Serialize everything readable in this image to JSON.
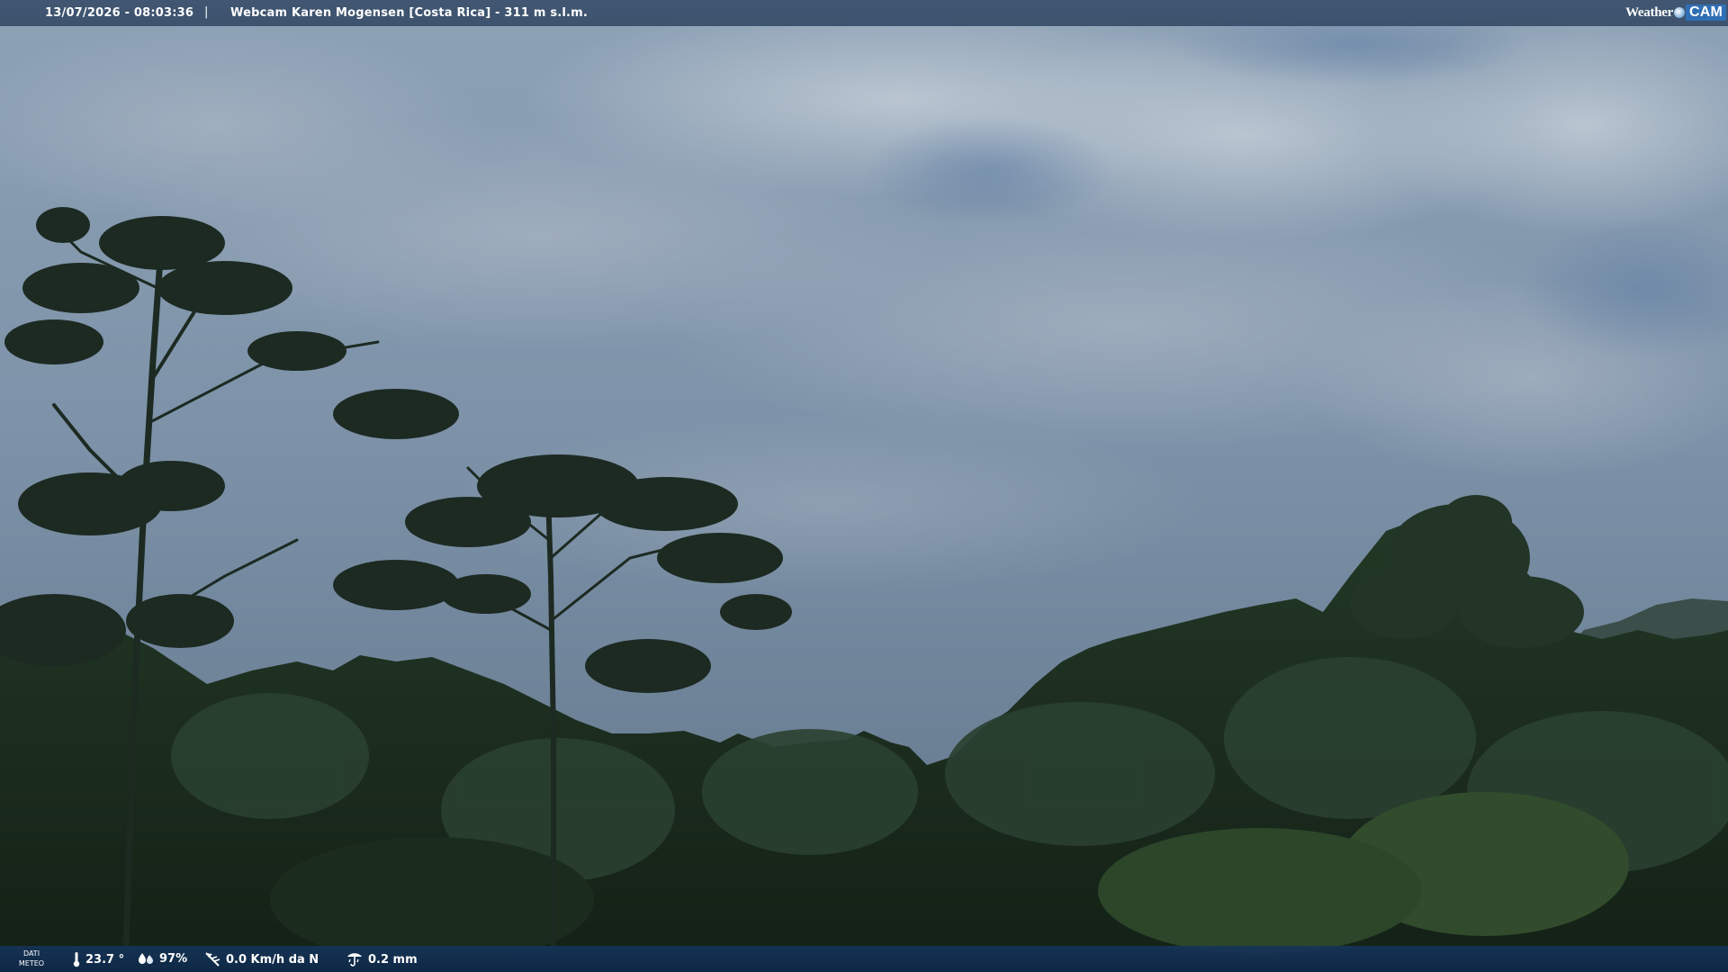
{
  "header": {
    "datetime": "13/07/2026 - 08:03:36",
    "separator": "|",
    "title": "Webcam Karen Mogensen [Costa Rica]  - 311 m s.l.m."
  },
  "logo": {
    "weather_text": "Weather",
    "cam_text": "CAM",
    "icon": "globe-icon"
  },
  "footer": {
    "label_line1": "DATI",
    "label_line2": "METEO",
    "temperature": {
      "icon": "thermometer-icon",
      "value": "23.7 °"
    },
    "humidity": {
      "icon": "humidity-icon",
      "value": "97%"
    },
    "wind": {
      "icon": "wind-icon",
      "value": "0.0 Km/h da N"
    },
    "rain": {
      "icon": "rain-gauge-icon",
      "value": "0.2 mm"
    }
  },
  "colors": {
    "sky_top": "#8fa3b8",
    "sky_bottom": "#5f7488",
    "foliage": "#1e3020",
    "header_bg": "#3c526e",
    "footer_bg": "#163458",
    "logo_accent": "#2f6fb5"
  }
}
